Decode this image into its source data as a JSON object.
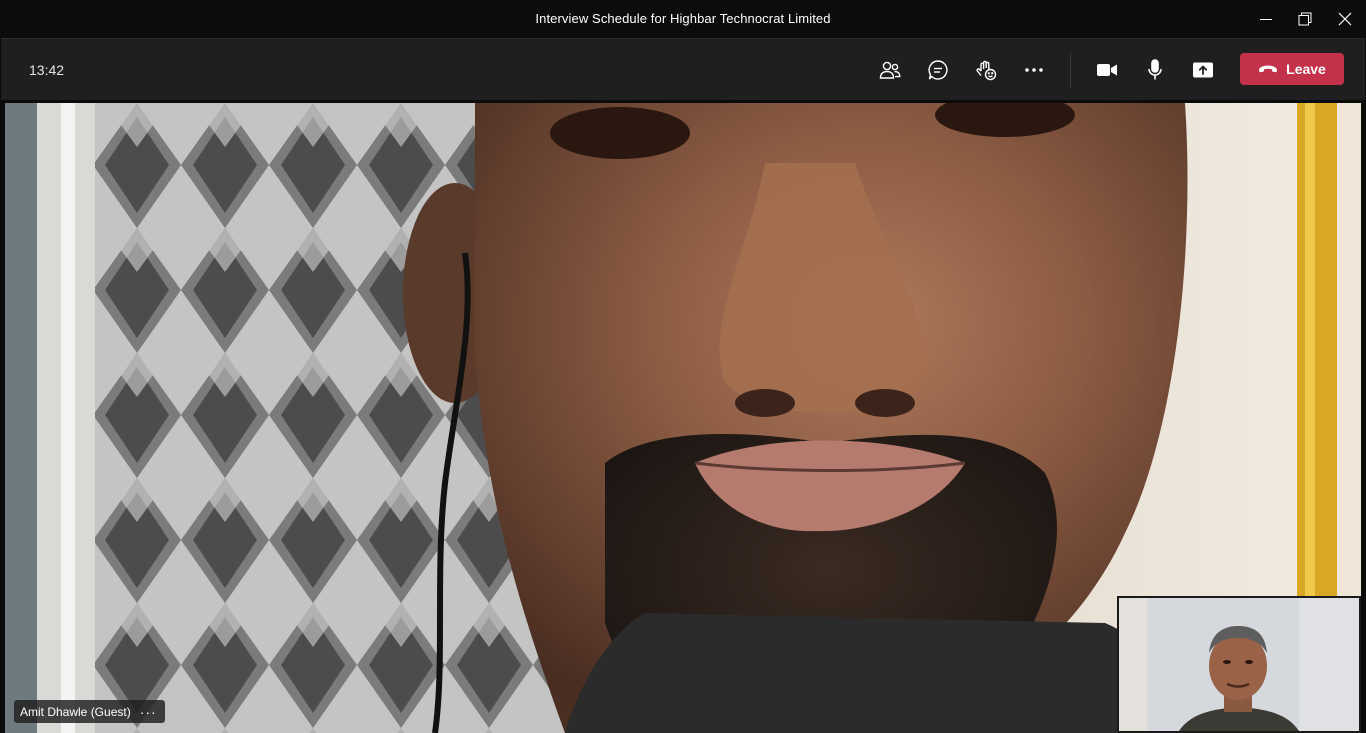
{
  "window": {
    "title": "Interview Schedule for Highbar Technocrat Limited",
    "controls": [
      "minimize-icon",
      "restore-icon",
      "close-icon"
    ]
  },
  "toolbar": {
    "time": "13:42",
    "buttons": [
      "participants-icon",
      "chat-icon",
      "reactions-icon",
      "more-icon",
      "camera-icon",
      "mic-icon",
      "share-icon"
    ],
    "leave_label": "Leave",
    "leave_color": "#c4314b"
  },
  "main_video": {
    "participant_name": "Amit Dhawle (Guest)",
    "more_label": "···"
  },
  "self_view": {
    "present": true
  }
}
